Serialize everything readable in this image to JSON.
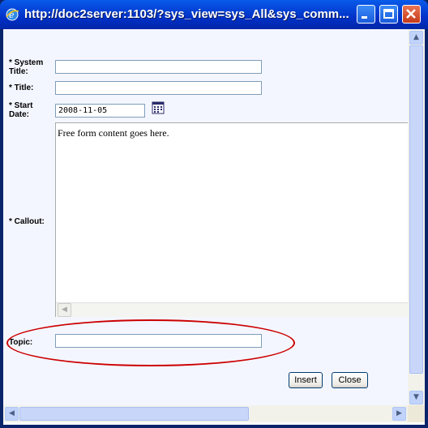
{
  "window": {
    "title": "http://doc2server:1103/?sys_view=sys_All&sys_comm..."
  },
  "form": {
    "system_title": {
      "label_line1": "* System",
      "label_line2": "Title:",
      "value": ""
    },
    "title": {
      "label": "* Title:",
      "value": ""
    },
    "start_date": {
      "label_line1": "* Start",
      "label_line2": "Date:",
      "value": "2008-11-05"
    },
    "callout": {
      "label": "* Callout:",
      "content": "Free form content goes here."
    },
    "topic": {
      "label": "Topic:",
      "value": ""
    }
  },
  "buttons": {
    "insert": "Insert",
    "close": "Close"
  },
  "annotation": {
    "color": "#CC0000",
    "shape": "ellipse",
    "target": "topic"
  }
}
